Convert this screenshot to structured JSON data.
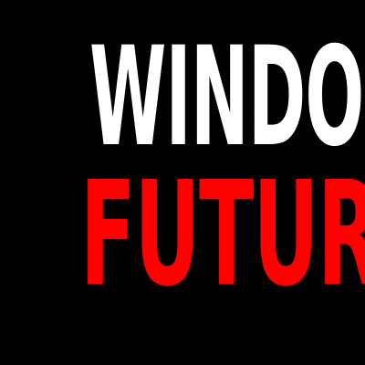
{
  "logo": {
    "line1": "WINDOWS",
    "line2": "FUTURES",
    "colors": {
      "background": "#000000",
      "line1": "#ffffff",
      "line2": "#ff0000"
    }
  }
}
